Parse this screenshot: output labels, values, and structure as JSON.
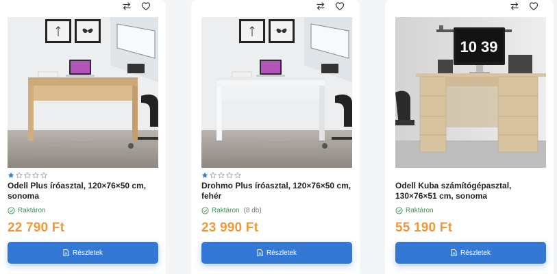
{
  "colors": {
    "accent": "#3378d4",
    "price": "#ee9a3c",
    "in_stock": "#2e9a48",
    "star_filled": "#3378d4"
  },
  "icons": {
    "compare": "compare-arrows-icon",
    "wishlist": "heart-icon",
    "stock": "check-circle-icon",
    "details": "document-icon"
  },
  "products": [
    {
      "title": "Odell Plus íróasztal, 120×76×50 cm, sonoma",
      "rating": 1,
      "rating_max": 5,
      "stock_label": "Raktáron",
      "stock_count": "",
      "price": "22 790 Ft",
      "details_label": "Részletek"
    },
    {
      "title": "Drohmo Plus íróasztal, 120×76×50 cm, fehér",
      "rating": 1,
      "rating_max": 5,
      "stock_label": "Raktáron",
      "stock_count": "(8 db)",
      "price": "23 990 Ft",
      "details_label": "Részletek"
    },
    {
      "title": "Odell Kuba számítógépasztal, 130×76×51 cm, sonoma",
      "rating": 0,
      "rating_max": 0,
      "stock_label": "Raktáron",
      "stock_count": "",
      "price": "55 190 Ft",
      "details_label": "Részletek",
      "image_clock": "10 39"
    }
  ]
}
